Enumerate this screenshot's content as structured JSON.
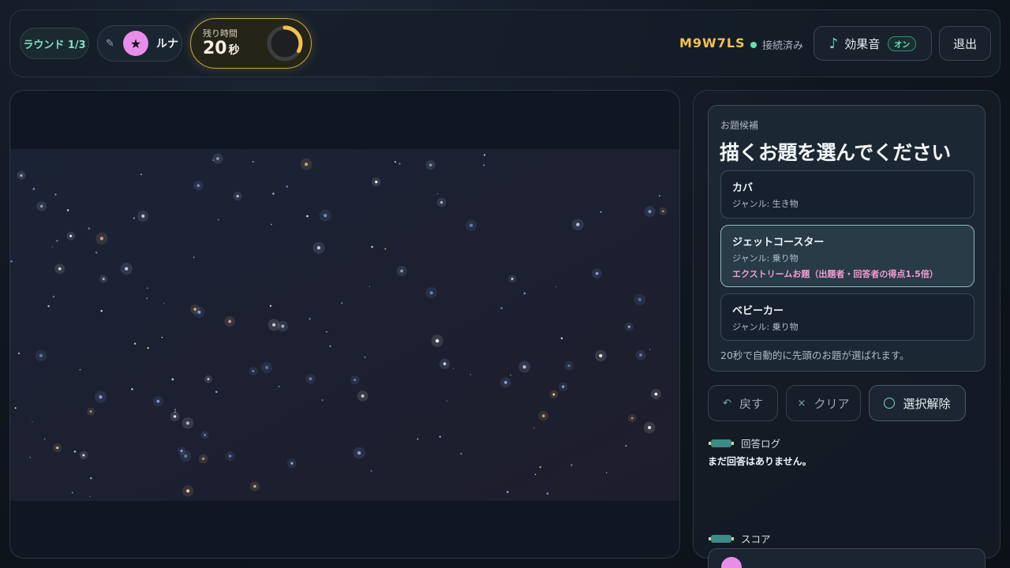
{
  "header": {
    "round_label": "ラウンド 1/3",
    "drawer": {
      "icon": "pencil-icon",
      "avatar_icon": "star-icon",
      "avatar_glyph": "★",
      "name": "ルナ",
      "avatar_color": "#e88ee8"
    },
    "timer": {
      "label": "残り時間",
      "value": "20",
      "unit": "秒",
      "remaining_fraction": 0.33
    },
    "room_code": "M9W7LS",
    "connection_status": "接続済み",
    "sound": {
      "icon": "music-note-icon",
      "glyph": "♪",
      "label": "効果音",
      "state": "オン"
    },
    "exit_label": "退出"
  },
  "topic_picker": {
    "eyebrow": "お題候補",
    "heading": "描くお題を選んでください",
    "options": [
      {
        "name": "カバ",
        "genre": "ジャンル: 生き物",
        "extreme": ""
      },
      {
        "name": "ジェットコースター",
        "genre": "ジャンル: 乗り物",
        "extreme": "エクストリームお題（出題者・回答者の得点1.5倍）"
      },
      {
        "name": "ベビーカー",
        "genre": "ジャンル: 乗り物",
        "extreme": ""
      }
    ],
    "selected_index": 1,
    "hint": "20秒で自動的に先頭のお題が選ばれます。"
  },
  "tools": {
    "undo": {
      "icon": "undo-icon",
      "glyph": "↶",
      "label": "戻す"
    },
    "clear": {
      "icon": "clear-icon",
      "glyph": "×",
      "label": "クリア"
    },
    "deselect": {
      "icon": "circle-icon",
      "label": "選択解除"
    }
  },
  "answer_log": {
    "title": "回答ログ",
    "empty_text": "まだ回答はありません。"
  },
  "score": {
    "title": "スコア"
  },
  "colors": {
    "accent": "#f2c14e",
    "teal": "#6fd6c8",
    "pink": "#f39bd4",
    "online": "#5fe0b0"
  }
}
